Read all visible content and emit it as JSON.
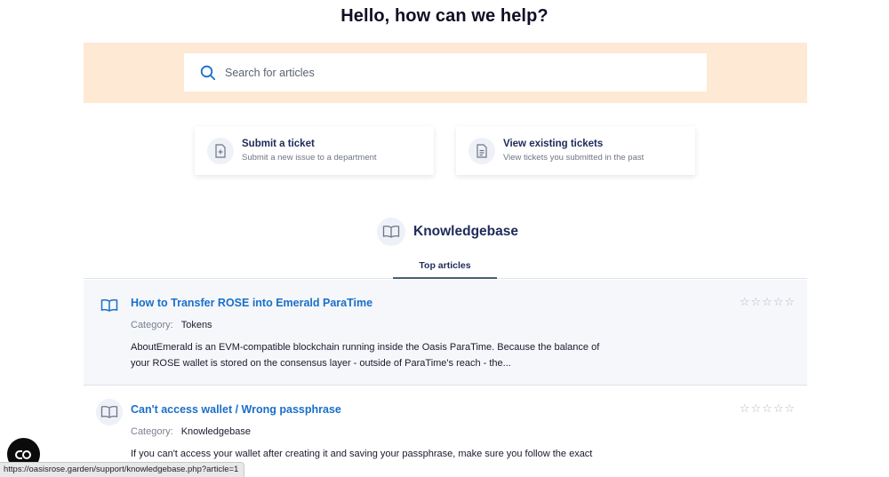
{
  "header": {
    "title": "Hello, how can we help?"
  },
  "search": {
    "placeholder": "Search for articles"
  },
  "actions": [
    {
      "title": "Submit a ticket",
      "subtitle": "Submit a new issue to a department",
      "icon": "file-plus-icon"
    },
    {
      "title": "View existing tickets",
      "subtitle": "View tickets you submitted in the past",
      "icon": "file-text-icon"
    }
  ],
  "knowledgebase": {
    "heading": "Knowledgebase",
    "icon": "book-open-icon",
    "tabs": [
      {
        "label": "Top articles",
        "active": true
      }
    ],
    "articles": [
      {
        "title": "How to Transfer ROSE into Emerald ParaTime",
        "category_label": "Category:",
        "category": "Tokens",
        "description": "AboutEmerald is an EVM-compatible blockchain running inside the Oasis ParaTime. Because the balance of your ROSE wallet is stored on the consensus layer - outside of ParaTime's reach - the...",
        "rating": 0
      },
      {
        "title": "Can't access wallet / Wrong passphrase",
        "category_label": "Category:",
        "category": "Knowledgebase",
        "description": "If you can't access your wallet after creating it and saving your passphrase, make sure you follow the exact",
        "rating": 0
      }
    ]
  },
  "status_bar": {
    "url": "https://oasisrose.garden/support/knowledgebase.php?article=1"
  },
  "chat": {
    "icon": "chat-icon"
  },
  "colors": {
    "accent": "#1a6fc9",
    "band": "#fde9d4",
    "navy": "#1e2a5a"
  }
}
